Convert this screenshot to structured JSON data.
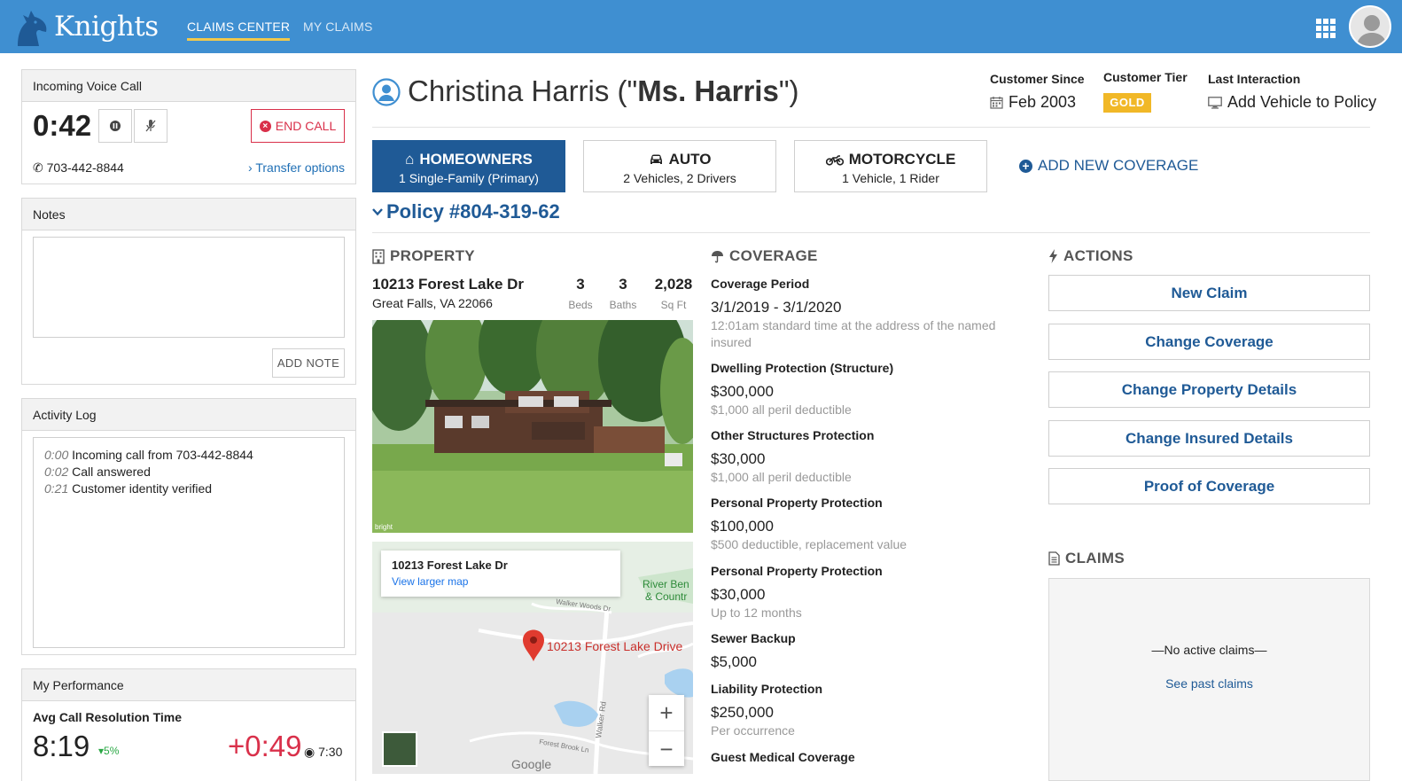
{
  "app": {
    "brand": "Knights",
    "nav_tabs": [
      {
        "label": "CLAIMS CENTER",
        "active": true
      },
      {
        "label": "MY CLAIMS",
        "active": false
      }
    ]
  },
  "call": {
    "header": "Incoming Voice Call",
    "timer": "0:42",
    "end_call_label": "END CALL",
    "phone": "703-442-8844",
    "transfer_label": "Transfer options"
  },
  "notes": {
    "header": "Notes",
    "value": "",
    "add_label": "ADD NOTE"
  },
  "activity_log": {
    "header": "Activity Log",
    "entries": [
      {
        "time": "0:00",
        "text": "Incoming call from 703-442-8844"
      },
      {
        "time": "0:02",
        "text": "Call answered"
      },
      {
        "time": "0:21",
        "text": "Customer identity verified"
      }
    ]
  },
  "performance": {
    "header": "My Performance",
    "metric_title": "Avg Call Resolution Time",
    "value": "8:19",
    "delta": "5%",
    "delta_direction": "down",
    "current": "+0:49",
    "target": "7:30"
  },
  "customer": {
    "name_plain": "Christina Harris (\"",
    "nickname": "Ms. Harris",
    "name_close": "\")",
    "since_label": "Customer Since",
    "since_value": "Feb 2003",
    "tier_label": "Customer Tier",
    "tier_value": "GOLD",
    "last_label": "Last Interaction",
    "last_value": "Add Vehicle to Policy"
  },
  "coverage_tabs": [
    {
      "title": "HOMEOWNERS",
      "subtitle": "1 Single-Family (Primary)",
      "icon": "home-icon",
      "active": true
    },
    {
      "title": "AUTO",
      "subtitle": "2 Vehicles, 2 Drivers",
      "icon": "car-icon",
      "active": false
    },
    {
      "title": "MOTORCYCLE",
      "subtitle": "1 Vehicle, 1 Rider",
      "icon": "motorcycle-icon",
      "active": false
    }
  ],
  "add_coverage_label": "ADD NEW COVERAGE",
  "policy_label": "Policy #804-319-62",
  "property": {
    "heading": "PROPERTY",
    "address": "10213 Forest Lake Dr",
    "city": "Great Falls, VA 22066",
    "stats": [
      {
        "num": "3",
        "label": "Beds"
      },
      {
        "num": "3",
        "label": "Baths"
      },
      {
        "num": "2,028",
        "label": "Sq Ft"
      }
    ],
    "photo_credit": "bright",
    "map": {
      "card_title": "10213 Forest Lake Dr",
      "card_link": "View larger map",
      "pin_label": "10213 Forest Lake Drive",
      "poi_label_1": "River Ben",
      "poi_label_2": "& Countr",
      "road_1": "Walker Woods Dr",
      "road_2": "Walker Rd",
      "road_3": "Forest Brook Ln",
      "provider": "Google",
      "zoom_in": "+",
      "zoom_out": "−"
    }
  },
  "coverage": {
    "heading": "COVERAGE",
    "period_label": "Coverage Period",
    "period_value": "3/1/2019 - 3/1/2020",
    "period_note": "12:01am standard time at the address of the named insured",
    "items": [
      {
        "label": "Dwelling Protection (Structure)",
        "value": "$300,000",
        "note": "$1,000 all peril deductible"
      },
      {
        "label": "Other Structures Protection",
        "value": "$30,000",
        "note": "$1,000 all peril deductible"
      },
      {
        "label": "Personal Property Protection",
        "value": "$100,000",
        "note": "$500 deductible, replacement value"
      },
      {
        "label": "Personal Property Protection",
        "value": "$30,000",
        "note": "Up to 12 months"
      },
      {
        "label": "Sewer Backup",
        "value": "$5,000",
        "note": ""
      },
      {
        "label": "Liability Protection",
        "value": "$250,000",
        "note": "Per occurrence"
      },
      {
        "label": "Guest Medical Coverage",
        "value": "",
        "note": ""
      }
    ]
  },
  "actions": {
    "heading": "ACTIONS",
    "buttons": [
      "New Claim",
      "Change Coverage",
      "Change Property Details",
      "Change Insured Details",
      "Proof of Coverage"
    ]
  },
  "claims": {
    "heading": "CLAIMS",
    "empty_text": "—No active claims—",
    "past_link": "See past claims"
  },
  "colors": {
    "topbar": "#3f8fd1",
    "primary": "#1f5a96",
    "danger": "#d9304a",
    "gold": "#f1b827",
    "positive": "#2aa845"
  }
}
